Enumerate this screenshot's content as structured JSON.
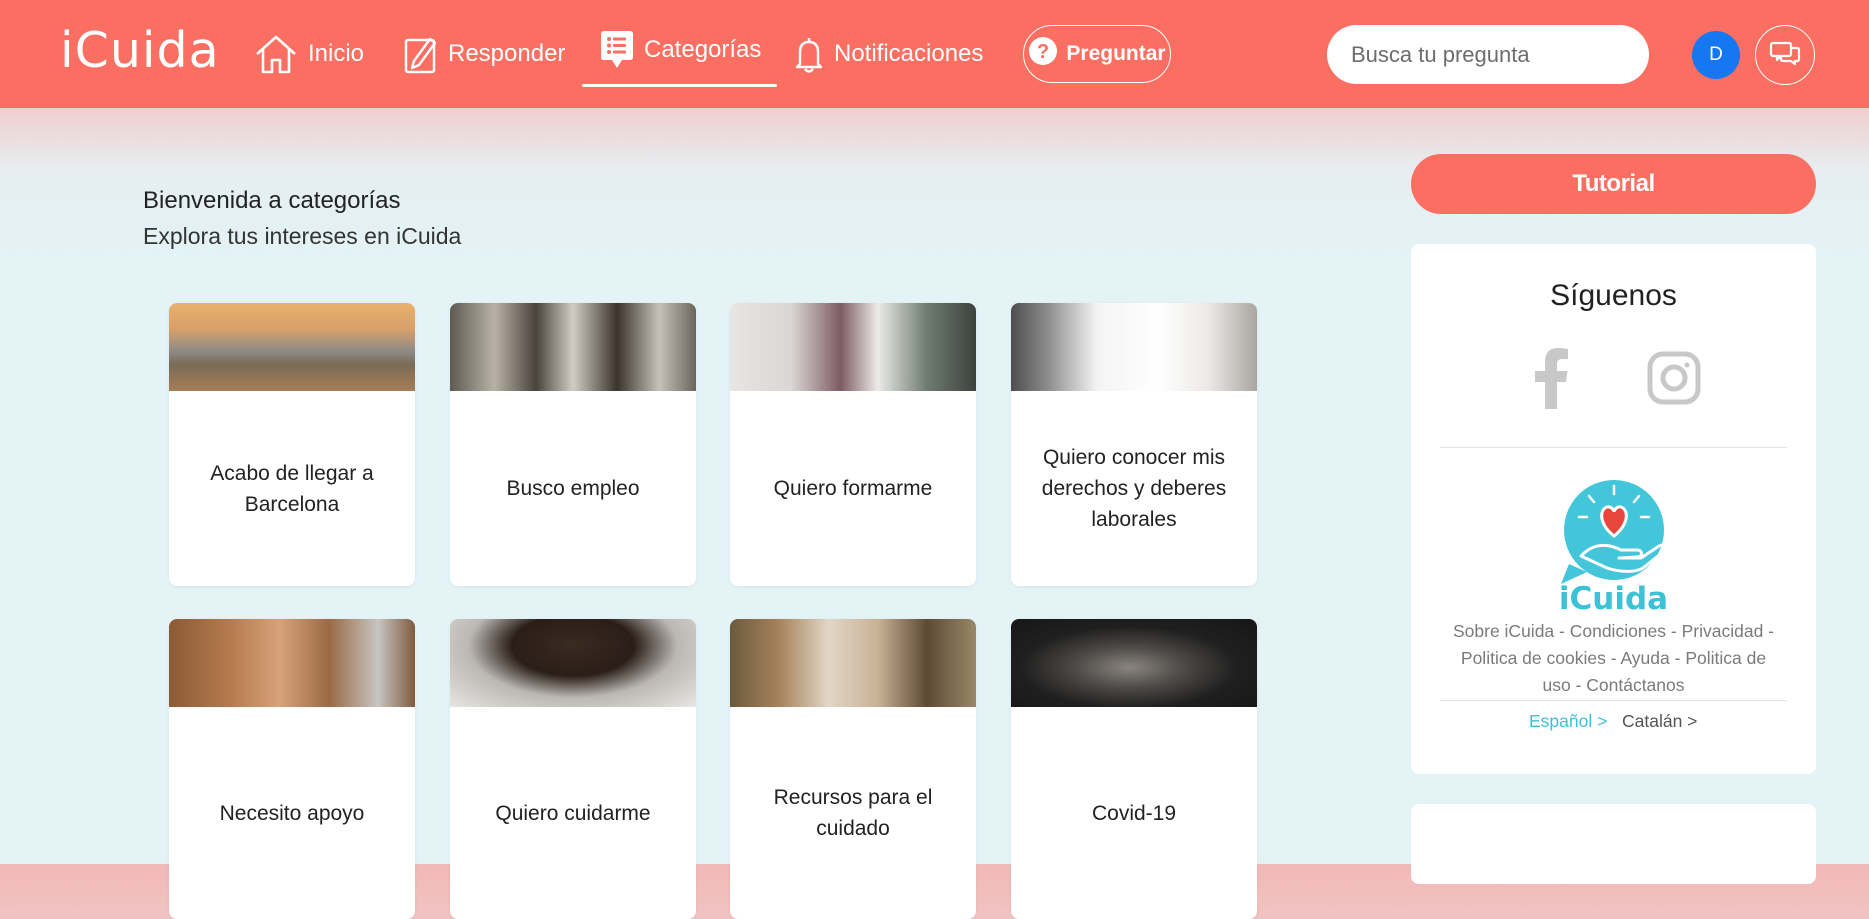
{
  "header": {
    "logo": "iCuida",
    "nav": [
      {
        "label": "Inicio",
        "icon": "home-icon"
      },
      {
        "label": "Responder",
        "icon": "pencil-icon"
      },
      {
        "label": "Categorías",
        "icon": "list-icon",
        "active": true
      },
      {
        "label": "Notificaciones",
        "icon": "bell-icon"
      }
    ],
    "ask_button": "Preguntar",
    "search_placeholder": "Busca tu pregunta",
    "avatar_initial": "D"
  },
  "main": {
    "welcome_title": "Bienvenida a categorías",
    "welcome_subtitle": "Explora tus intereses en iCuida",
    "categories": [
      {
        "label": "Acabo de llegar a Barcelona",
        "photo": "barcelona-skyline"
      },
      {
        "label": "Busco empleo",
        "photo": "women-at-laptop"
      },
      {
        "label": "Quiero formarme",
        "photo": "whiteboard-training"
      },
      {
        "label": "Quiero conocer mis derechos y deberes laborales",
        "photo": "document-handover"
      },
      {
        "label": "Necesito apoyo",
        "photo": "hands-together"
      },
      {
        "label": "Quiero cuidarme",
        "photo": "smiling-woman"
      },
      {
        "label": "Recursos para el cuidado",
        "photo": "elderly-care"
      },
      {
        "label": "Covid-19",
        "photo": "woman-with-mask"
      }
    ]
  },
  "sidebar": {
    "tutorial_button": "Tutorial",
    "follow_title": "Síguenos",
    "social": [
      "facebook-icon",
      "instagram-icon"
    ],
    "brand_name": "iCuida",
    "footer_links": [
      "Sobre iCuida",
      "Condiciones",
      "Privacidad",
      "Politica de cookies",
      "Ayuda",
      "Politica de uso",
      "Contáctanos"
    ],
    "languages": [
      {
        "label": "Español >",
        "active": true
      },
      {
        "label": "Catalán >",
        "active": false
      }
    ]
  },
  "colors": {
    "accent": "#fa6f62",
    "avatar": "#1677f2",
    "brand_teal": "#3cc2d6",
    "background": "#e3f3f6"
  }
}
